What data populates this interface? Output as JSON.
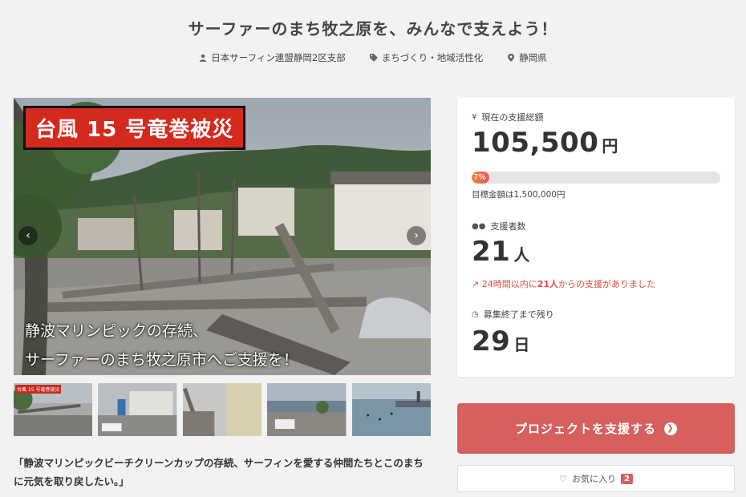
{
  "project": {
    "title": "サーファーのまち牧之原を、みんなで支えよう！",
    "owner": "日本サーフィン連盟静岡2区支部",
    "category": "まちづくり・地域活性化",
    "location": "静岡県"
  },
  "hero": {
    "overlay_label": "台風 15 号竜巻被災",
    "caption_line1": "静波マリンピックの存続、",
    "caption_line2": "サーファーのまち牧之原市へご支援を！",
    "prev_icon": "‹",
    "next_icon": "›"
  },
  "thumbnails": [
    {
      "label": "台風 15 号竜巻被災"
    },
    {
      "label": ""
    },
    {
      "label": ""
    },
    {
      "label": ""
    },
    {
      "label": ""
    }
  ],
  "quote": "「静波マリンピックビーチクリーンカップの存続、サーフィンを愛する仲間たちとこのまちに元気を取り戻したい。」",
  "stats": {
    "total_label": "現在の支援総額",
    "total_amount": "105,500",
    "total_unit": "円",
    "progress_percent": 7,
    "progress_text": "7%",
    "goal_text": "目標金額は1,500,000円",
    "supporters_label": "支援者数",
    "supporters_count": "21",
    "supporters_unit": "人",
    "recent_prefix": "24時間以内に",
    "recent_count": "21人",
    "recent_suffix": "からの支援がありました",
    "remaining_label": "募集終了まで残り",
    "remaining_days": "29",
    "remaining_unit": "日"
  },
  "actions": {
    "support_label": "プロジェクトを支援する",
    "favorite_label": "お気に入り",
    "favorite_count": "2"
  },
  "colors": {
    "accent": "#d7605f",
    "alert": "#e24a3b",
    "label_red": "#d42a1e"
  }
}
